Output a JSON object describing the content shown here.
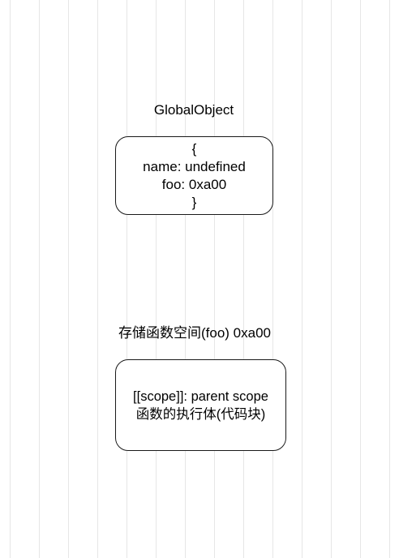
{
  "global_object": {
    "title": "GlobalObject",
    "lines": [
      "{",
      "name: undefined",
      "foo: 0xa00",
      "}"
    ]
  },
  "foo_storage": {
    "title": "存储函数空间(foo) 0xa00",
    "lines": [
      "[[scope]]: parent scope",
      "函数的执行体(代码块)"
    ]
  }
}
